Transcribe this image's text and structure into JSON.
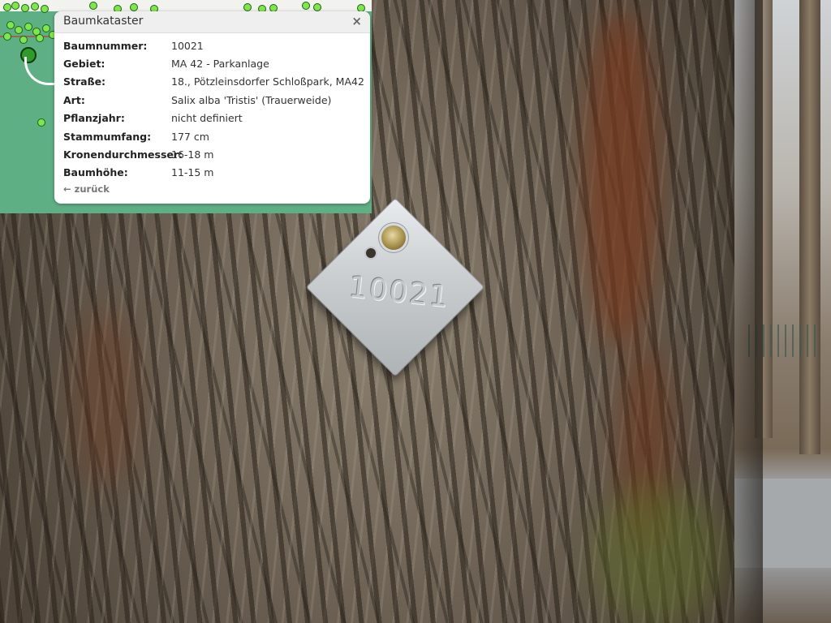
{
  "popup": {
    "title": "Baumkataster",
    "close_icon": "×",
    "rows": [
      {
        "label": "Baumnummer:",
        "value": "10021"
      },
      {
        "label": "Gebiet:",
        "value": "MA 42 - Parkanlage"
      },
      {
        "label": "Straße:",
        "value": "18., Pötzleinsdorfer Schloßpark, MA42"
      },
      {
        "label": "Art:",
        "value": "Salix alba 'Tristis' (Trauerweide)"
      },
      {
        "label": "Pflanzjahr:",
        "value": "nicht definiert"
      },
      {
        "label": "Stammumfang:",
        "value": "177 cm"
      },
      {
        "label": "Kronendurchmesser:",
        "value": "16-18 m"
      },
      {
        "label": "Baumhöhe:",
        "value": "11-15 m"
      }
    ],
    "back_arrow": "←",
    "back_label": "zurück"
  },
  "photo": {
    "tag_number": "10021"
  },
  "colors": {
    "map_green": "#5faf85",
    "tree_dot": "#7ee84a",
    "selected_marker": "#2f9b2a"
  }
}
